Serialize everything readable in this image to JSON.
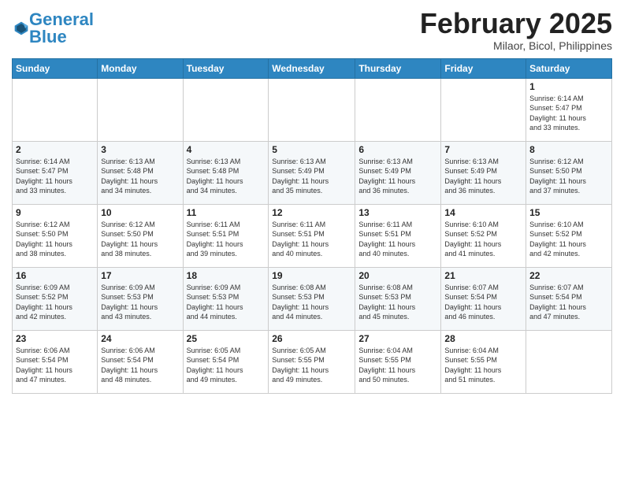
{
  "logo": {
    "text1": "General",
    "text2": "Blue"
  },
  "header": {
    "month": "February 2025",
    "location": "Milaor, Bicol, Philippines"
  },
  "weekdays": [
    "Sunday",
    "Monday",
    "Tuesday",
    "Wednesday",
    "Thursday",
    "Friday",
    "Saturday"
  ],
  "weeks": [
    [
      {
        "day": "",
        "info": ""
      },
      {
        "day": "",
        "info": ""
      },
      {
        "day": "",
        "info": ""
      },
      {
        "day": "",
        "info": ""
      },
      {
        "day": "",
        "info": ""
      },
      {
        "day": "",
        "info": ""
      },
      {
        "day": "1",
        "info": "Sunrise: 6:14 AM\nSunset: 5:47 PM\nDaylight: 11 hours\nand 33 minutes."
      }
    ],
    [
      {
        "day": "2",
        "info": "Sunrise: 6:14 AM\nSunset: 5:47 PM\nDaylight: 11 hours\nand 33 minutes."
      },
      {
        "day": "3",
        "info": "Sunrise: 6:13 AM\nSunset: 5:48 PM\nDaylight: 11 hours\nand 34 minutes."
      },
      {
        "day": "4",
        "info": "Sunrise: 6:13 AM\nSunset: 5:48 PM\nDaylight: 11 hours\nand 34 minutes."
      },
      {
        "day": "5",
        "info": "Sunrise: 6:13 AM\nSunset: 5:49 PM\nDaylight: 11 hours\nand 35 minutes."
      },
      {
        "day": "6",
        "info": "Sunrise: 6:13 AM\nSunset: 5:49 PM\nDaylight: 11 hours\nand 36 minutes."
      },
      {
        "day": "7",
        "info": "Sunrise: 6:13 AM\nSunset: 5:49 PM\nDaylight: 11 hours\nand 36 minutes."
      },
      {
        "day": "8",
        "info": "Sunrise: 6:12 AM\nSunset: 5:50 PM\nDaylight: 11 hours\nand 37 minutes."
      }
    ],
    [
      {
        "day": "9",
        "info": "Sunrise: 6:12 AM\nSunset: 5:50 PM\nDaylight: 11 hours\nand 38 minutes."
      },
      {
        "day": "10",
        "info": "Sunrise: 6:12 AM\nSunset: 5:50 PM\nDaylight: 11 hours\nand 38 minutes."
      },
      {
        "day": "11",
        "info": "Sunrise: 6:11 AM\nSunset: 5:51 PM\nDaylight: 11 hours\nand 39 minutes."
      },
      {
        "day": "12",
        "info": "Sunrise: 6:11 AM\nSunset: 5:51 PM\nDaylight: 11 hours\nand 40 minutes."
      },
      {
        "day": "13",
        "info": "Sunrise: 6:11 AM\nSunset: 5:51 PM\nDaylight: 11 hours\nand 40 minutes."
      },
      {
        "day": "14",
        "info": "Sunrise: 6:10 AM\nSunset: 5:52 PM\nDaylight: 11 hours\nand 41 minutes."
      },
      {
        "day": "15",
        "info": "Sunrise: 6:10 AM\nSunset: 5:52 PM\nDaylight: 11 hours\nand 42 minutes."
      }
    ],
    [
      {
        "day": "16",
        "info": "Sunrise: 6:09 AM\nSunset: 5:52 PM\nDaylight: 11 hours\nand 42 minutes."
      },
      {
        "day": "17",
        "info": "Sunrise: 6:09 AM\nSunset: 5:53 PM\nDaylight: 11 hours\nand 43 minutes."
      },
      {
        "day": "18",
        "info": "Sunrise: 6:09 AM\nSunset: 5:53 PM\nDaylight: 11 hours\nand 44 minutes."
      },
      {
        "day": "19",
        "info": "Sunrise: 6:08 AM\nSunset: 5:53 PM\nDaylight: 11 hours\nand 44 minutes."
      },
      {
        "day": "20",
        "info": "Sunrise: 6:08 AM\nSunset: 5:53 PM\nDaylight: 11 hours\nand 45 minutes."
      },
      {
        "day": "21",
        "info": "Sunrise: 6:07 AM\nSunset: 5:54 PM\nDaylight: 11 hours\nand 46 minutes."
      },
      {
        "day": "22",
        "info": "Sunrise: 6:07 AM\nSunset: 5:54 PM\nDaylight: 11 hours\nand 47 minutes."
      }
    ],
    [
      {
        "day": "23",
        "info": "Sunrise: 6:06 AM\nSunset: 5:54 PM\nDaylight: 11 hours\nand 47 minutes."
      },
      {
        "day": "24",
        "info": "Sunrise: 6:06 AM\nSunset: 5:54 PM\nDaylight: 11 hours\nand 48 minutes."
      },
      {
        "day": "25",
        "info": "Sunrise: 6:05 AM\nSunset: 5:54 PM\nDaylight: 11 hours\nand 49 minutes."
      },
      {
        "day": "26",
        "info": "Sunrise: 6:05 AM\nSunset: 5:55 PM\nDaylight: 11 hours\nand 49 minutes."
      },
      {
        "day": "27",
        "info": "Sunrise: 6:04 AM\nSunset: 5:55 PM\nDaylight: 11 hours\nand 50 minutes."
      },
      {
        "day": "28",
        "info": "Sunrise: 6:04 AM\nSunset: 5:55 PM\nDaylight: 11 hours\nand 51 minutes."
      },
      {
        "day": "",
        "info": ""
      }
    ]
  ]
}
